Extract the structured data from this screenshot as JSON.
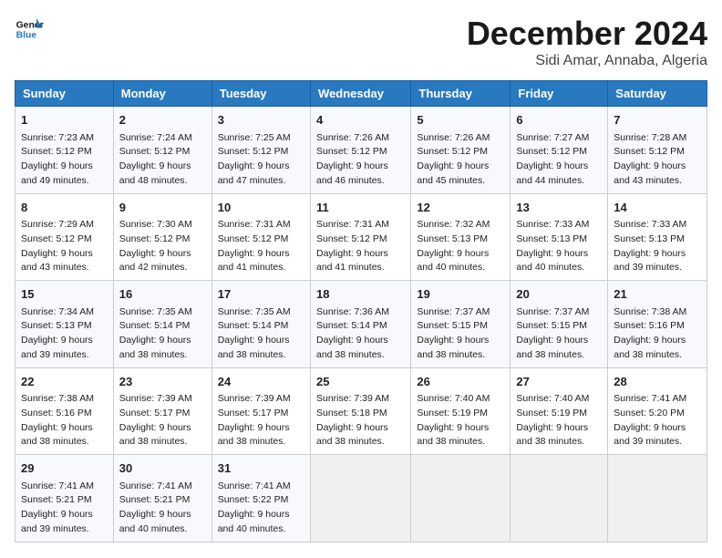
{
  "header": {
    "logo_line1": "General",
    "logo_line2": "Blue",
    "month_title": "December 2024",
    "location": "Sidi Amar, Annaba, Algeria"
  },
  "weekdays": [
    "Sunday",
    "Monday",
    "Tuesday",
    "Wednesday",
    "Thursday",
    "Friday",
    "Saturday"
  ],
  "weeks": [
    [
      {
        "day": "1",
        "sunrise": "Sunrise: 7:23 AM",
        "sunset": "Sunset: 5:12 PM",
        "daylight": "Daylight: 9 hours and 49 minutes."
      },
      {
        "day": "2",
        "sunrise": "Sunrise: 7:24 AM",
        "sunset": "Sunset: 5:12 PM",
        "daylight": "Daylight: 9 hours and 48 minutes."
      },
      {
        "day": "3",
        "sunrise": "Sunrise: 7:25 AM",
        "sunset": "Sunset: 5:12 PM",
        "daylight": "Daylight: 9 hours and 47 minutes."
      },
      {
        "day": "4",
        "sunrise": "Sunrise: 7:26 AM",
        "sunset": "Sunset: 5:12 PM",
        "daylight": "Daylight: 9 hours and 46 minutes."
      },
      {
        "day": "5",
        "sunrise": "Sunrise: 7:26 AM",
        "sunset": "Sunset: 5:12 PM",
        "daylight": "Daylight: 9 hours and 45 minutes."
      },
      {
        "day": "6",
        "sunrise": "Sunrise: 7:27 AM",
        "sunset": "Sunset: 5:12 PM",
        "daylight": "Daylight: 9 hours and 44 minutes."
      },
      {
        "day": "7",
        "sunrise": "Sunrise: 7:28 AM",
        "sunset": "Sunset: 5:12 PM",
        "daylight": "Daylight: 9 hours and 43 minutes."
      }
    ],
    [
      {
        "day": "8",
        "sunrise": "Sunrise: 7:29 AM",
        "sunset": "Sunset: 5:12 PM",
        "daylight": "Daylight: 9 hours and 43 minutes."
      },
      {
        "day": "9",
        "sunrise": "Sunrise: 7:30 AM",
        "sunset": "Sunset: 5:12 PM",
        "daylight": "Daylight: 9 hours and 42 minutes."
      },
      {
        "day": "10",
        "sunrise": "Sunrise: 7:31 AM",
        "sunset": "Sunset: 5:12 PM",
        "daylight": "Daylight: 9 hours and 41 minutes."
      },
      {
        "day": "11",
        "sunrise": "Sunrise: 7:31 AM",
        "sunset": "Sunset: 5:12 PM",
        "daylight": "Daylight: 9 hours and 41 minutes."
      },
      {
        "day": "12",
        "sunrise": "Sunrise: 7:32 AM",
        "sunset": "Sunset: 5:13 PM",
        "daylight": "Daylight: 9 hours and 40 minutes."
      },
      {
        "day": "13",
        "sunrise": "Sunrise: 7:33 AM",
        "sunset": "Sunset: 5:13 PM",
        "daylight": "Daylight: 9 hours and 40 minutes."
      },
      {
        "day": "14",
        "sunrise": "Sunrise: 7:33 AM",
        "sunset": "Sunset: 5:13 PM",
        "daylight": "Daylight: 9 hours and 39 minutes."
      }
    ],
    [
      {
        "day": "15",
        "sunrise": "Sunrise: 7:34 AM",
        "sunset": "Sunset: 5:13 PM",
        "daylight": "Daylight: 9 hours and 39 minutes."
      },
      {
        "day": "16",
        "sunrise": "Sunrise: 7:35 AM",
        "sunset": "Sunset: 5:14 PM",
        "daylight": "Daylight: 9 hours and 38 minutes."
      },
      {
        "day": "17",
        "sunrise": "Sunrise: 7:35 AM",
        "sunset": "Sunset: 5:14 PM",
        "daylight": "Daylight: 9 hours and 38 minutes."
      },
      {
        "day": "18",
        "sunrise": "Sunrise: 7:36 AM",
        "sunset": "Sunset: 5:14 PM",
        "daylight": "Daylight: 9 hours and 38 minutes."
      },
      {
        "day": "19",
        "sunrise": "Sunrise: 7:37 AM",
        "sunset": "Sunset: 5:15 PM",
        "daylight": "Daylight: 9 hours and 38 minutes."
      },
      {
        "day": "20",
        "sunrise": "Sunrise: 7:37 AM",
        "sunset": "Sunset: 5:15 PM",
        "daylight": "Daylight: 9 hours and 38 minutes."
      },
      {
        "day": "21",
        "sunrise": "Sunrise: 7:38 AM",
        "sunset": "Sunset: 5:16 PM",
        "daylight": "Daylight: 9 hours and 38 minutes."
      }
    ],
    [
      {
        "day": "22",
        "sunrise": "Sunrise: 7:38 AM",
        "sunset": "Sunset: 5:16 PM",
        "daylight": "Daylight: 9 hours and 38 minutes."
      },
      {
        "day": "23",
        "sunrise": "Sunrise: 7:39 AM",
        "sunset": "Sunset: 5:17 PM",
        "daylight": "Daylight: 9 hours and 38 minutes."
      },
      {
        "day": "24",
        "sunrise": "Sunrise: 7:39 AM",
        "sunset": "Sunset: 5:17 PM",
        "daylight": "Daylight: 9 hours and 38 minutes."
      },
      {
        "day": "25",
        "sunrise": "Sunrise: 7:39 AM",
        "sunset": "Sunset: 5:18 PM",
        "daylight": "Daylight: 9 hours and 38 minutes."
      },
      {
        "day": "26",
        "sunrise": "Sunrise: 7:40 AM",
        "sunset": "Sunset: 5:19 PM",
        "daylight": "Daylight: 9 hours and 38 minutes."
      },
      {
        "day": "27",
        "sunrise": "Sunrise: 7:40 AM",
        "sunset": "Sunset: 5:19 PM",
        "daylight": "Daylight: 9 hours and 38 minutes."
      },
      {
        "day": "28",
        "sunrise": "Sunrise: 7:41 AM",
        "sunset": "Sunset: 5:20 PM",
        "daylight": "Daylight: 9 hours and 39 minutes."
      }
    ],
    [
      {
        "day": "29",
        "sunrise": "Sunrise: 7:41 AM",
        "sunset": "Sunset: 5:21 PM",
        "daylight": "Daylight: 9 hours and 39 minutes."
      },
      {
        "day": "30",
        "sunrise": "Sunrise: 7:41 AM",
        "sunset": "Sunset: 5:21 PM",
        "daylight": "Daylight: 9 hours and 40 minutes."
      },
      {
        "day": "31",
        "sunrise": "Sunrise: 7:41 AM",
        "sunset": "Sunset: 5:22 PM",
        "daylight": "Daylight: 9 hours and 40 minutes."
      },
      null,
      null,
      null,
      null
    ]
  ]
}
